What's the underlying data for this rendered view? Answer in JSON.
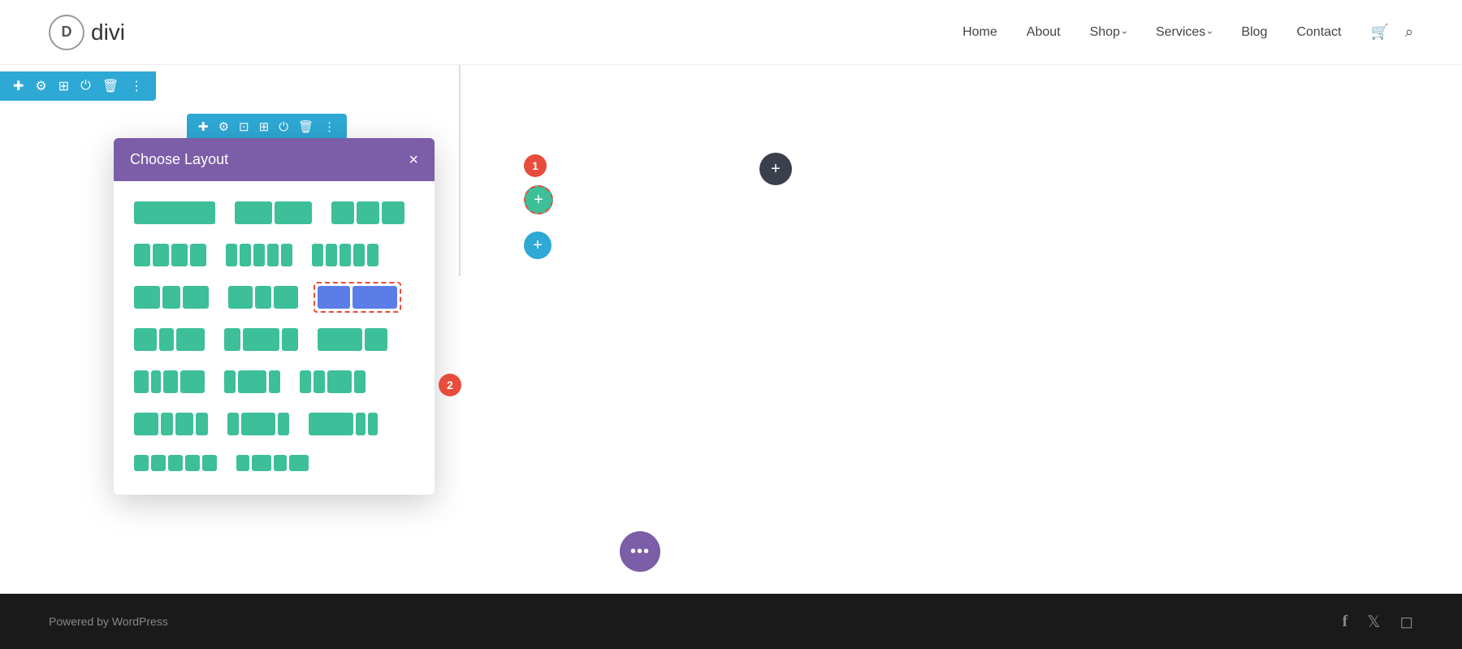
{
  "header": {
    "logo_letter": "D",
    "logo_name": "divi",
    "nav_items": [
      {
        "label": "Home",
        "has_dropdown": false
      },
      {
        "label": "About",
        "has_dropdown": false
      },
      {
        "label": "Shop",
        "has_dropdown": true
      },
      {
        "label": "Services",
        "has_dropdown": true
      },
      {
        "label": "Blog",
        "has_dropdown": false
      },
      {
        "label": "Contact",
        "has_dropdown": false
      }
    ]
  },
  "top_toolbar": {
    "icons": [
      "plus",
      "gear",
      "layout",
      "power",
      "trash",
      "dots"
    ]
  },
  "row_toolbar": {
    "icons": [
      "plus",
      "gear",
      "layout",
      "grid",
      "power",
      "trash",
      "dots"
    ]
  },
  "modal": {
    "title": "Choose Layout",
    "close_label": "×"
  },
  "badge_1": "1",
  "badge_2": "2",
  "footer": {
    "text": "ordPress",
    "icon_facebook": "f",
    "icon_twitter": "t",
    "icon_instagram": "□"
  },
  "float_btn": "···"
}
